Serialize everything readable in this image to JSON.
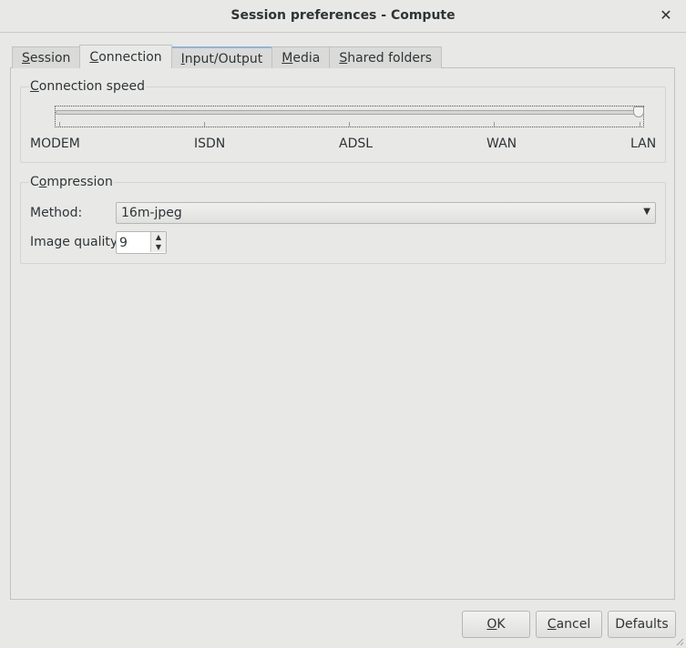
{
  "window": {
    "title": "Session preferences - Compute",
    "close_glyph": "✕"
  },
  "tabs": [
    {
      "pre": "",
      "ul": "S",
      "post": "ession"
    },
    {
      "pre": "",
      "ul": "C",
      "post": "onnection"
    },
    {
      "pre": "",
      "ul": "I",
      "post": "nput/Output"
    },
    {
      "pre": "",
      "ul": "M",
      "post": "edia"
    },
    {
      "pre": "",
      "ul": "S",
      "post": "hared folders"
    }
  ],
  "connection_speed": {
    "title_pre": "",
    "title_ul": "C",
    "title_post": "onnection speed",
    "levels": [
      "MODEM",
      "ISDN",
      "ADSL",
      "WAN",
      "LAN"
    ],
    "selected": "LAN"
  },
  "compression": {
    "title_pre": "C",
    "title_ul": "o",
    "title_post": "mpression",
    "method_label": "Method:",
    "method_value": "16m-jpeg",
    "quality_label": "Image quality:",
    "quality_value": "9"
  },
  "buttons": {
    "ok_ul": "O",
    "ok_post": "K",
    "cancel_ul": "C",
    "cancel_post": "ancel",
    "defaults": "Defaults"
  },
  "icons": {
    "combo_arrow": "▼",
    "spin_up": "▲",
    "spin_down": "▼"
  }
}
